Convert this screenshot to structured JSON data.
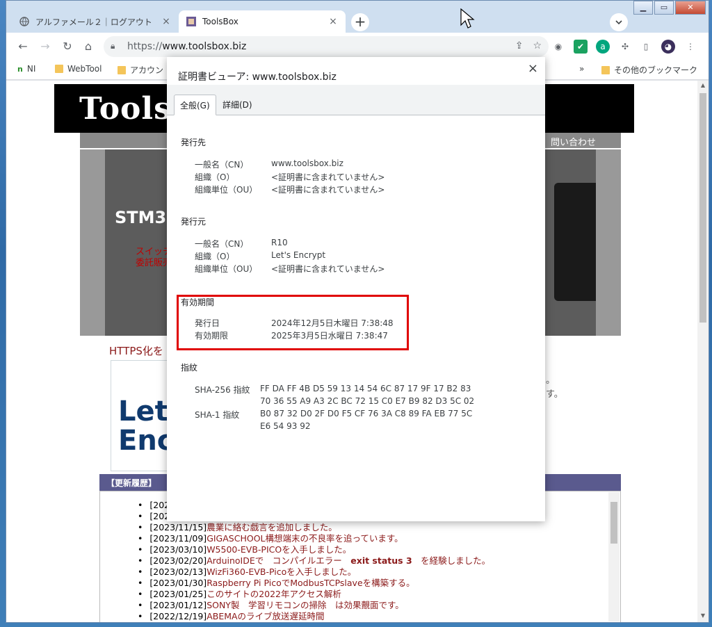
{
  "browser": {
    "tabs": [
      {
        "title": "アルファメール２｜ログアウト"
      },
      {
        "title": "ToolsBox"
      }
    ],
    "new_tab_label": "+",
    "tab_search_icon": "chevron-down-icon",
    "url_scheme": "https://",
    "url_host": "www.toolsbox.biz"
  },
  "bookmarks": {
    "items": [
      "NI",
      "WebTool",
      "アカウン"
    ],
    "overflow": "»",
    "other": "その他のブックマーク"
  },
  "site": {
    "logo": "Toolsb",
    "nav_contact": "問い合わせ",
    "hero_title": "STM3",
    "hero_sub_1": "スイッチ",
    "hero_sub_2": "委託販売",
    "https_title": "HTTPS化を",
    "le_line1": "Let'",
    "le_line2": "Enc",
    "side_text_1": "。",
    "side_text_2": "す。",
    "news_head": "【更新履歴】",
    "news": [
      {
        "date": "[202",
        "text": ""
      },
      {
        "date": "[202",
        "text": ""
      },
      {
        "date": "[2023/11/15]",
        "text": "農業に絡む戯言を追加しました。"
      },
      {
        "date": "[2023/11/09]",
        "text": "GIGASCHOOL構想端末の不良率を追っています。"
      },
      {
        "date": "[2023/03/10]",
        "text": "W5500-EVB-PICOを入手しました。"
      },
      {
        "date": "[2023/02/20]",
        "text": "ArduinoIDEで　コンパイルエラー　",
        "strong": "exit status 3",
        "tail": "　を経験しました。"
      },
      {
        "date": "[2023/02/13]",
        "text": "WizFi360-EVB-Picoを入手しました。"
      },
      {
        "date": "[2023/01/30]",
        "text": "Raspberry Pi PicoでModbusTCPslaveを構築する。"
      },
      {
        "date": "[2023/01/25]",
        "text": "このサイトの2022年アクセス解析"
      },
      {
        "date": "[2023/01/12]",
        "text": "SONY製　学習リモコンの掃除　は効果覿面です。"
      },
      {
        "date": "[2022/12/19]",
        "text": "ABEMAのライブ放送遅延時間"
      }
    ]
  },
  "dialog": {
    "title": "証明書ビューア: www.toolsbox.biz",
    "close": "×",
    "tab_general": "全般(G)",
    "tab_details": "詳細(D)",
    "issued_to_header": "発行先",
    "issued_to": [
      {
        "k": "一般名（CN）",
        "v": "www.toolsbox.biz"
      },
      {
        "k": "組織（O）",
        "v": "<証明書に含まれていません>"
      },
      {
        "k": "組織単位（OU）",
        "v": "<証明書に含まれていません>"
      }
    ],
    "issued_by_header": "発行元",
    "issued_by": [
      {
        "k": "一般名（CN）",
        "v": "R10"
      },
      {
        "k": "組織（O）",
        "v": "Let's Encrypt"
      },
      {
        "k": "組織単位（OU）",
        "v": "<証明書に含まれていません>"
      }
    ],
    "validity_header": "有効期間",
    "validity": [
      {
        "k": "発行日",
        "v": "2024年12月5日木曜日 7:38:48"
      },
      {
        "k": "有効期限",
        "v": "2025年3月5日水曜日 7:38:47"
      }
    ],
    "fingerprint_header": "指紋",
    "sha256_label": "SHA-256 指紋",
    "sha256_line1": "FF DA FF 4B D5 59 13 14 54 6C 87 17 9F 17 B2 83",
    "sha256_line2": "70 36 55 A9 A3 2C BC 72 15 C0 E7 B9 82 D3 5C 02",
    "sha1_label": "SHA-1 指紋",
    "sha1_line1": "B0 87 32 D0 2F D0 F5 CF 76 3A C8 89 FA EB 77 5C",
    "sha1_line2": "E6 54 93 92"
  },
  "colors": {
    "highlight": "#e00000",
    "news_head_bg": "#5a5a8e",
    "link_text": "#8b1a1a"
  }
}
